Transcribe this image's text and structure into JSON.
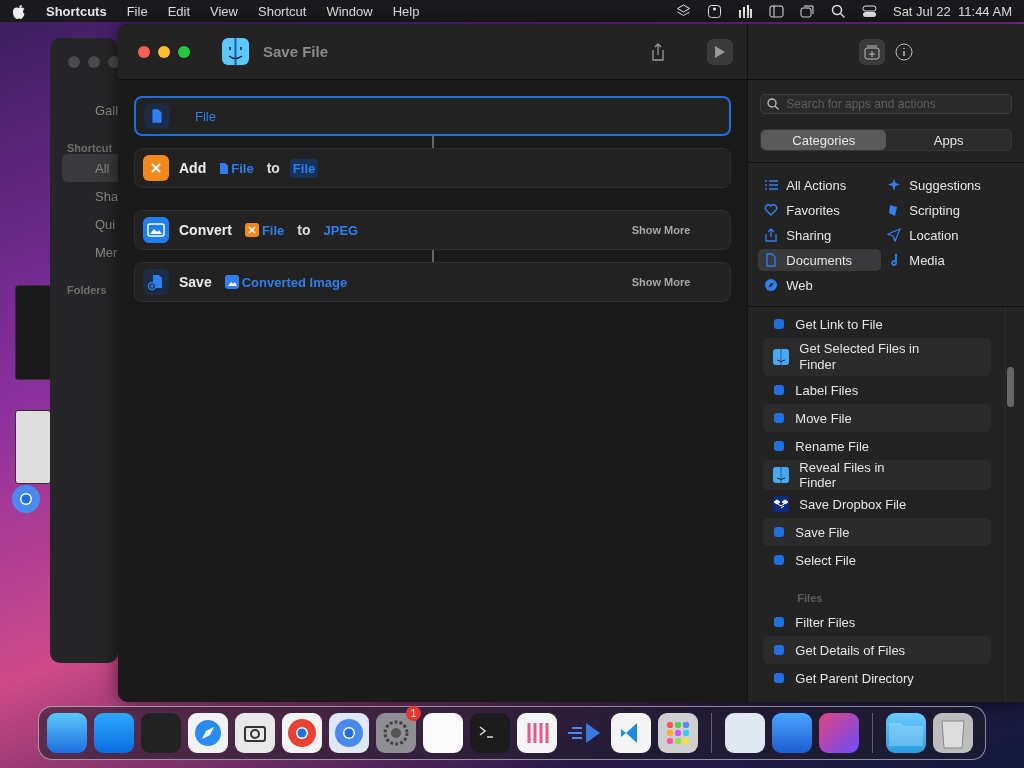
{
  "menubar": {
    "app": "Shortcuts",
    "menus": [
      "File",
      "Edit",
      "View",
      "Shortcut",
      "Window",
      "Help"
    ],
    "date": "Sat Jul 22",
    "time": "11:44 AM"
  },
  "background_window": {
    "sidebar": [
      {
        "kind": "item",
        "label": "Gall",
        "selected": false
      },
      {
        "kind": "header",
        "label": "Shortcut"
      },
      {
        "kind": "item",
        "label": "All",
        "selected": true
      },
      {
        "kind": "item",
        "label": "Sha",
        "selected": false
      },
      {
        "kind": "item",
        "label": "Qui",
        "selected": false
      },
      {
        "kind": "item",
        "label": "Mer",
        "selected": false
      },
      {
        "kind": "header",
        "label": "Folders"
      }
    ]
  },
  "window": {
    "title": "Save File"
  },
  "actions": [
    {
      "kind": "variable",
      "selected": true,
      "parts": [
        {
          "kind": "plain",
          "text": "File"
        }
      ]
    },
    {
      "kind": "action",
      "selected": false,
      "verb": "Add",
      "parts": [
        {
          "kind": "file-variable",
          "text": "File"
        },
        {
          "kind": "word",
          "text": "to"
        },
        {
          "kind": "param",
          "text": "File"
        }
      ]
    },
    {
      "kind": "action",
      "selected": false,
      "verb": "Convert",
      "parts": [
        {
          "kind": "magic-variable",
          "text": "File"
        },
        {
          "kind": "word",
          "text": "to"
        },
        {
          "kind": "plain",
          "text": "JPEG"
        }
      ],
      "show_more": "Show More"
    },
    {
      "kind": "action",
      "selected": false,
      "verb": "Save",
      "parts": [
        {
          "kind": "image-variable",
          "text": "Converted Image"
        }
      ],
      "show_more": "Show More"
    }
  ],
  "library": {
    "search": {
      "placeholder": "Search for apps and actions"
    },
    "segments": [
      {
        "label": "Categories",
        "selected": true
      },
      {
        "label": "Apps",
        "selected": false
      }
    ],
    "categories": [
      {
        "label": "All Actions",
        "selected": false
      },
      {
        "label": "Suggestions",
        "selected": false
      },
      {
        "label": "Favorites",
        "selected": false
      },
      {
        "label": "Scripting",
        "selected": false
      },
      {
        "label": "Sharing",
        "selected": false
      },
      {
        "label": "Location",
        "selected": false
      },
      {
        "label": "Documents",
        "selected": true
      },
      {
        "label": "Media",
        "selected": false
      },
      {
        "label": "Web",
        "selected": false
      }
    ],
    "items": [
      {
        "kind": "action",
        "label": "Get Link to File"
      },
      {
        "kind": "finder-action",
        "label": "Get Selected Files in Finder"
      },
      {
        "kind": "action",
        "label": "Label Files"
      },
      {
        "kind": "action",
        "label": "Move File"
      },
      {
        "kind": "action",
        "label": "Rename File"
      },
      {
        "kind": "finder-action",
        "label": "Reveal Files in Finder"
      },
      {
        "kind": "dropbox-action",
        "label": "Save Dropbox File"
      },
      {
        "kind": "action",
        "label": "Save File"
      },
      {
        "kind": "action",
        "label": "Select File"
      },
      {
        "kind": "header",
        "label": "Files"
      },
      {
        "kind": "action",
        "label": "Filter Files"
      },
      {
        "kind": "action",
        "label": "Get Details of Files"
      },
      {
        "kind": "action",
        "label": "Get Parent Directory"
      }
    ]
  },
  "dock": {
    "settings_badge": "1"
  }
}
